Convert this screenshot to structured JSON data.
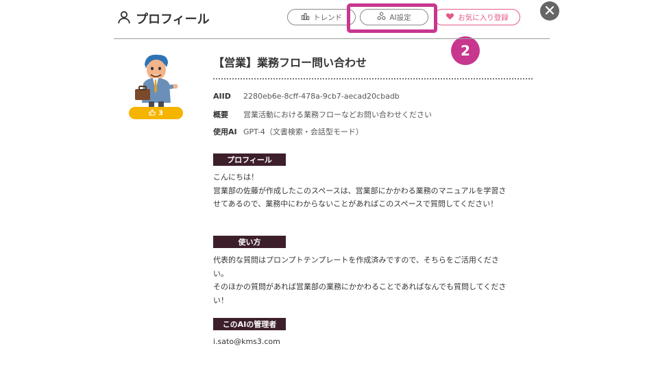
{
  "header": {
    "title": "プロフィール",
    "buttons": {
      "trend": "トレンド",
      "ai_settings": "AI設定",
      "favorite": "お気に入り登録"
    },
    "step_badge": "2"
  },
  "agent": {
    "likes": "3",
    "title": "【営業】業務フロー問い合わせ",
    "info": [
      {
        "key": "AIID",
        "value": "2280eb6e-8cff-478a-9cb7-aecad20cbadb"
      },
      {
        "key": "概要",
        "value": "営業活動における業務フローなどお問い合わせください"
      },
      {
        "key": "使用AI",
        "value": "GPT-4（文書検索・会話型モード）"
      }
    ]
  },
  "sections": {
    "profile": {
      "heading": "プロフィール",
      "lines": [
        "こんにちは！",
        "営業部の佐藤が作成したこのスペースは、営業部にかかわる業務のマニュアルを学習させてあるので、業務中にわからないことがあればこのスペースで質問してください！"
      ]
    },
    "usage": {
      "heading": "使い方",
      "lines": [
        "代表的な質問はプロンプトテンプレートを作成済みですので、そちらをご活用ください。",
        "そのほかの質問があれば営業部の業務にかかわることであればなんでも質問してください！"
      ]
    },
    "admin": {
      "heading": "このAIの管理者",
      "email": "i.sato@kms3.com"
    }
  },
  "colors": {
    "highlight": "#c8378e",
    "favorite": "#e45a87",
    "section_bg": "#3d1f2b",
    "like_badge": "#f5b400"
  }
}
